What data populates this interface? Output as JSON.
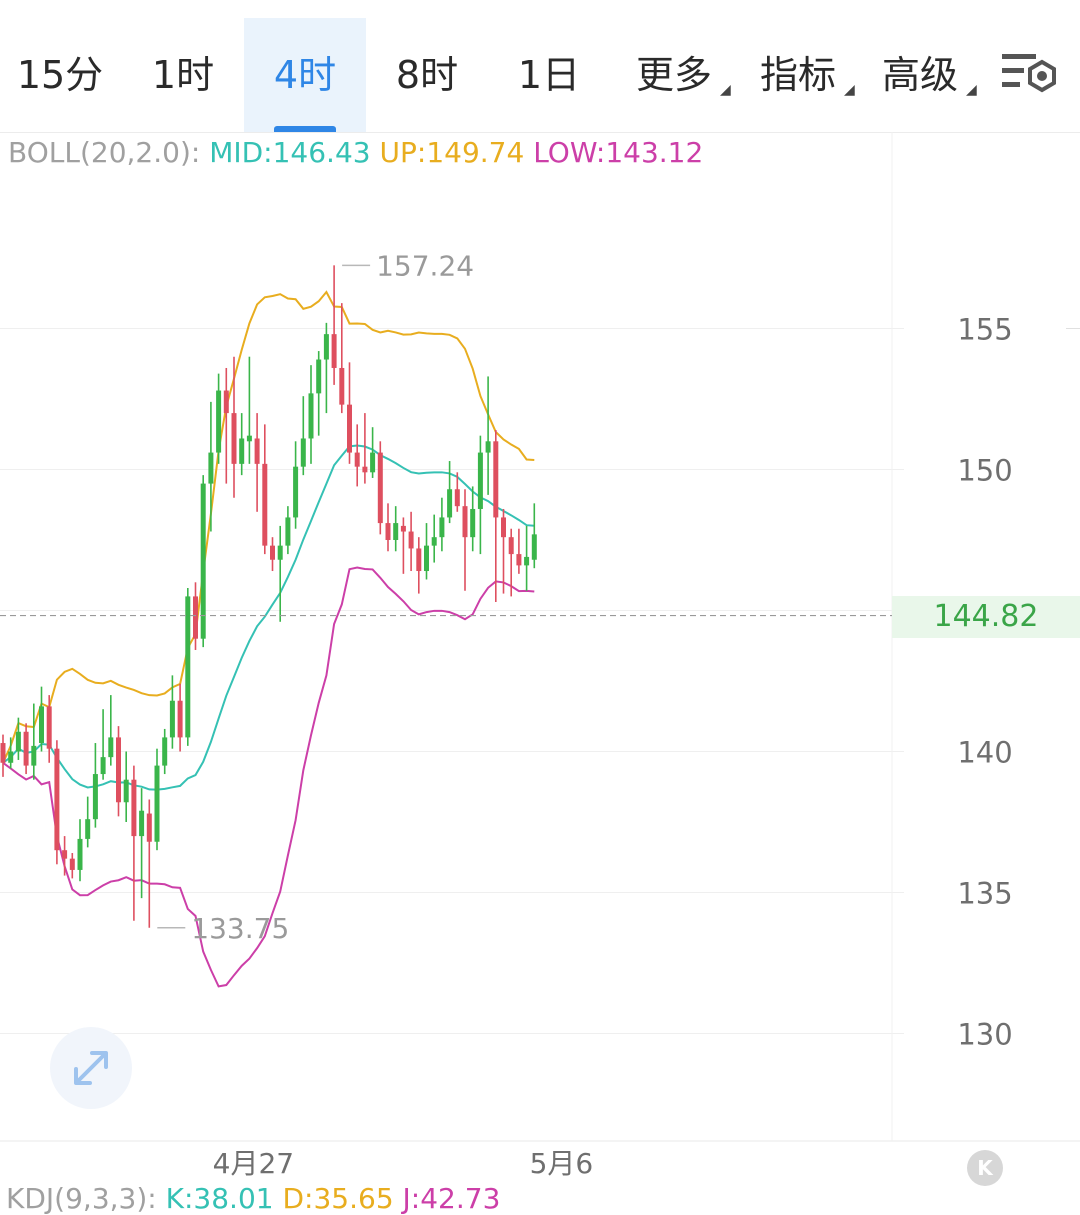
{
  "tabs": [
    {
      "label": "15分",
      "active": false
    },
    {
      "label": "1时",
      "active": false
    },
    {
      "label": "4时",
      "active": true
    },
    {
      "label": "8时",
      "active": false
    },
    {
      "label": "1日",
      "active": false
    },
    {
      "label": "更多",
      "active": false,
      "dropdown": true
    },
    {
      "label": "指标",
      "active": false,
      "dropdown": true
    },
    {
      "label": "高级",
      "active": false,
      "dropdown": true
    }
  ],
  "settings_icon": "chart-settings-icon",
  "indicator": {
    "name": "BOLL(20,2.0):",
    "mid": "MID:146.43",
    "up": "UP:149.74",
    "low": "LOW:143.12"
  },
  "current_price": "144.82",
  "expand_icon": "expand-arrows-icon",
  "k_badge": "K",
  "kdj": {
    "name": "KDJ(9,3,3):",
    "k": "K:38.01",
    "d": "D:35.65",
    "j": "J:42.73"
  },
  "colors": {
    "up_candle": "#3ab54a",
    "down_candle": "#de4f5f",
    "mid_line": "#35c1b4",
    "upper_band": "#e8ad1f",
    "lower_band": "#cc3fa8",
    "active_tab": "#2f86e6"
  },
  "chart_data": {
    "type": "candlestick",
    "y_ticks": [
      "155",
      "150",
      "145",
      "140",
      "135",
      "130"
    ],
    "y_tick_values": [
      155,
      150,
      145,
      140,
      135,
      130
    ],
    "x_ticks": [
      "4月27",
      "5月6"
    ],
    "x_tick_index": [
      32,
      72
    ],
    "high_label": "157.24",
    "low_label": "133.75",
    "last_price": 144.82,
    "candles": [
      [
        140.3,
        139.6,
        140.6,
        139.1
      ],
      [
        139.6,
        140.0,
        140.5,
        139.4
      ],
      [
        140.0,
        140.7,
        141.2,
        139.7
      ],
      [
        140.7,
        139.5,
        141.0,
        139.2
      ],
      [
        139.5,
        140.2,
        141.7,
        139.0
      ],
      [
        140.3,
        141.6,
        142.3,
        140.0
      ],
      [
        141.6,
        140.1,
        142.0,
        139.6
      ],
      [
        140.1,
        136.5,
        140.4,
        136.0
      ],
      [
        136.5,
        136.2,
        137.0,
        135.6
      ],
      [
        136.2,
        135.8,
        136.4,
        135.5
      ],
      [
        135.8,
        136.9,
        137.6,
        135.4
      ],
      [
        136.9,
        137.6,
        138.4,
        136.6
      ],
      [
        137.6,
        139.2,
        140.3,
        137.3
      ],
      [
        139.2,
        139.8,
        141.5,
        139.0
      ],
      [
        139.8,
        140.5,
        142.0,
        139.5
      ],
      [
        140.5,
        138.2,
        140.9,
        137.7
      ],
      [
        138.2,
        139.0,
        140.0,
        137.5
      ],
      [
        139.0,
        137.0,
        139.5,
        134.0
      ],
      [
        137.0,
        137.9,
        138.7,
        134.8
      ],
      [
        137.8,
        136.8,
        138.3,
        133.75
      ],
      [
        136.8,
        139.5,
        140.1,
        136.5
      ],
      [
        139.5,
        140.5,
        140.8,
        139.2
      ],
      [
        140.5,
        141.8,
        142.7,
        140.1
      ],
      [
        141.8,
        140.5,
        142.4,
        140.0
      ],
      [
        140.5,
        145.5,
        145.8,
        140.2
      ],
      [
        145.5,
        144.0,
        146.0,
        143.6
      ],
      [
        144.0,
        149.5,
        149.8,
        143.7
      ],
      [
        149.5,
        150.6,
        152.4,
        147.8
      ],
      [
        150.6,
        152.8,
        153.4,
        150.2
      ],
      [
        152.8,
        152.0,
        153.6,
        149.5
      ],
      [
        152.0,
        150.2,
        154.0,
        149.0
      ],
      [
        150.2,
        151.1,
        152.0,
        149.8
      ],
      [
        151.0,
        151.2,
        154.0,
        150.2
      ],
      [
        151.1,
        150.2,
        152.0,
        148.5
      ],
      [
        150.2,
        147.3,
        151.6,
        147.0
      ],
      [
        147.3,
        146.8,
        147.6,
        146.4
      ],
      [
        146.8,
        147.3,
        148.0,
        144.6
      ],
      [
        147.3,
        148.3,
        148.7,
        147.0
      ],
      [
        148.3,
        150.1,
        151.0,
        147.9
      ],
      [
        150.1,
        151.1,
        152.6,
        149.8
      ],
      [
        151.1,
        152.7,
        153.7,
        150.2
      ],
      [
        152.7,
        153.9,
        154.2,
        151.2
      ],
      [
        153.9,
        154.8,
        155.2,
        152.0
      ],
      [
        154.8,
        153.6,
        157.24,
        153.0
      ],
      [
        153.6,
        152.3,
        155.9,
        152.0
      ],
      [
        152.3,
        150.6,
        153.8,
        150.2
      ],
      [
        150.6,
        150.1,
        151.6,
        149.4
      ],
      [
        150.1,
        149.9,
        152.0,
        149.5
      ],
      [
        149.9,
        150.6,
        151.5,
        149.7
      ],
      [
        150.6,
        148.1,
        151.0,
        147.7
      ]
    ],
    "candles_2": [
      [
        148.1,
        147.5,
        148.8,
        147.1
      ],
      [
        147.5,
        148.1,
        148.7,
        147.1
      ],
      [
        148.0,
        147.8,
        148.3,
        146.3
      ],
      [
        147.8,
        147.2,
        148.5,
        146.4
      ],
      [
        147.2,
        146.4,
        147.6,
        145.6
      ],
      [
        146.4,
        147.3,
        148.1,
        146.1
      ],
      [
        147.3,
        147.6,
        148.4,
        146.7
      ],
      [
        147.6,
        148.3,
        149.0,
        147.1
      ],
      [
        148.3,
        149.3,
        150.3,
        148.1
      ],
      [
        149.3,
        148.7,
        149.9,
        148.5
      ],
      [
        148.7,
        147.6,
        149.3,
        145.7
      ],
      [
        147.6,
        148.6,
        149.4,
        147.1
      ],
      [
        148.6,
        150.6,
        151.2,
        147.0
      ],
      [
        150.6,
        151.0,
        153.3,
        149.1
      ],
      [
        151.0,
        148.3,
        151.4,
        145.3
      ],
      [
        148.3,
        147.6,
        148.6,
        145.6
      ],
      [
        147.6,
        147.0,
        147.9,
        145.5
      ],
      [
        147.0,
        146.6,
        147.9,
        146.3
      ],
      [
        146.6,
        146.9,
        148.0,
        145.7
      ],
      [
        146.8,
        147.7,
        148.8,
        146.5
      ]
    ]
  }
}
